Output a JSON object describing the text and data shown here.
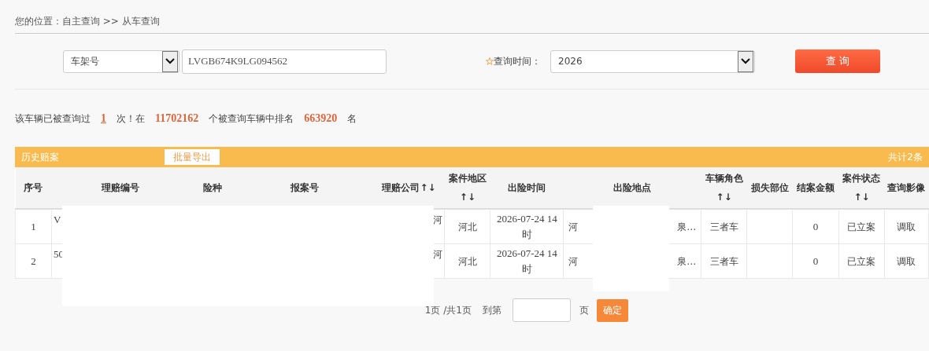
{
  "breadcrumb": "您的位置：自主查询 >> 从车查询",
  "search": {
    "type_select": "车架号",
    "value": "LVGB674K9LG094562",
    "time_label": "查询时间：",
    "time_select": "2026",
    "button": "查 询"
  },
  "summary": {
    "before": "该车辆已被查询过",
    "count": "1",
    "middle": "次！在",
    "total": "11702162",
    "middle2": "个被查询车辆中排名",
    "rank": "663920",
    "after": "名"
  },
  "section": {
    "title": "历史赔案",
    "export_button": "批量导出",
    "total": "共计2条"
  },
  "table": {
    "columns": [
      {
        "label": "序号"
      },
      {
        "label": "理赔编号"
      },
      {
        "label": "险种"
      },
      {
        "label": "报案号"
      },
      {
        "label": "理赔公司↑↓"
      },
      {
        "label": "案件地区↑↓"
      },
      {
        "label": "出险时间"
      },
      {
        "label": "出险地点"
      },
      {
        "label": "车辆角色↑↓"
      },
      {
        "label": "损失部位"
      },
      {
        "label": "结案金额"
      },
      {
        "label": "案件状态↑↓"
      },
      {
        "label": "查询影像"
      }
    ],
    "rows": [
      {
        "no": "1",
        "claim_no": "V",
        "company": "河",
        "region": "河北",
        "time": "2026-07-24 14时",
        "location_start": "河",
        "location_end": "泉…",
        "role": "三者车",
        "amount": "0",
        "status": "已立案",
        "image_link": "调取"
      },
      {
        "no": "2",
        "claim_no": "50",
        "company": "河",
        "region": "河北",
        "time": "2026-07-24 14时",
        "location_start": "河",
        "location_end": "泉…",
        "role": "三者车",
        "amount": "0",
        "status": "已立案",
        "image_link": "调取"
      }
    ]
  },
  "pagination": {
    "page_info": "1页 /共1页",
    "goto_label": "到第",
    "page_unit": "页",
    "confirm_button": "确定"
  }
}
